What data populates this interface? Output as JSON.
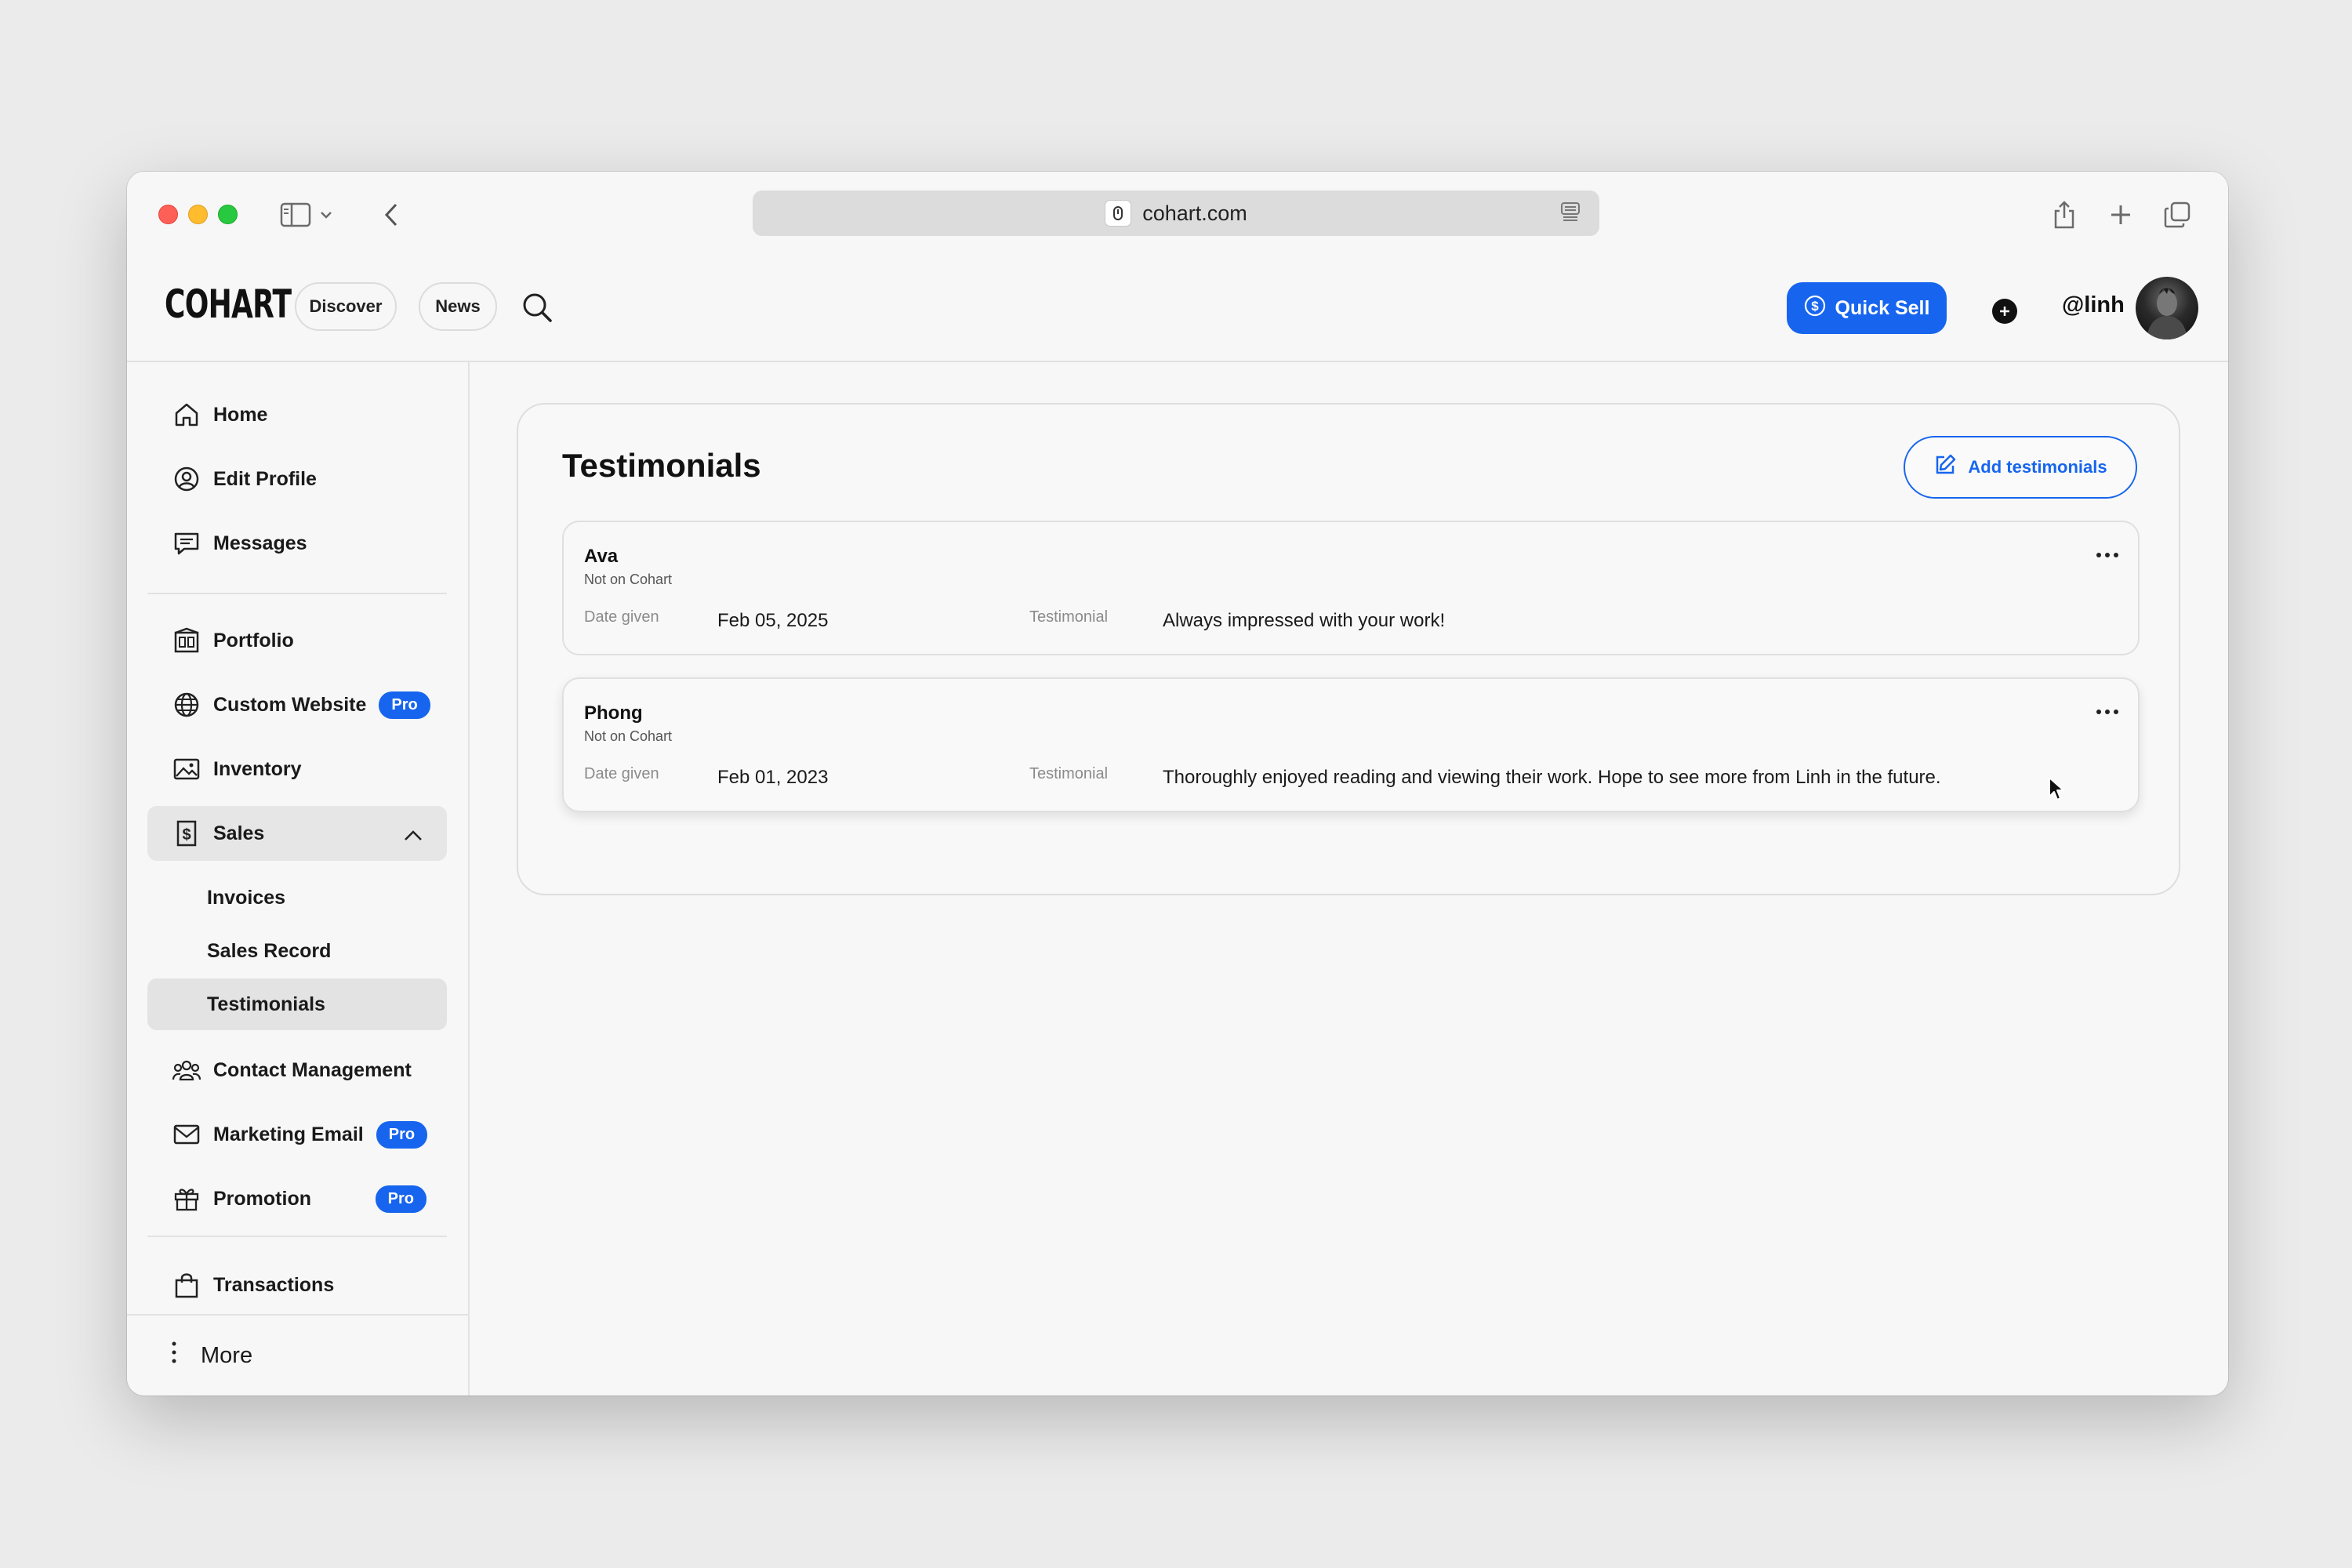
{
  "browser": {
    "url": "cohart.com"
  },
  "header": {
    "logo": "COHART",
    "nav": [
      "Discover",
      "News"
    ],
    "quick_sell_label": "Quick Sell",
    "username": "@linh"
  },
  "sidebar": {
    "items": [
      {
        "label": "Home",
        "icon": "home-icon"
      },
      {
        "label": "Edit Profile",
        "icon": "user-circle-icon"
      },
      {
        "label": "Messages",
        "icon": "chat-icon"
      },
      {
        "label": "Portfolio",
        "icon": "gallery-icon"
      },
      {
        "label": "Custom Website",
        "icon": "globe-icon",
        "badge": "Pro"
      },
      {
        "label": "Inventory",
        "icon": "image-icon"
      },
      {
        "label": "Sales",
        "icon": "dollar-doc-icon",
        "expanded": true,
        "children": [
          "Invoices",
          "Sales Record",
          "Testimonials"
        ],
        "active_child": "Testimonials"
      },
      {
        "label": "Contact Management",
        "icon": "people-icon"
      },
      {
        "label": "Marketing Email",
        "icon": "mail-icon",
        "badge": "Pro"
      },
      {
        "label": "Promotion",
        "icon": "gift-icon",
        "badge": "Pro"
      },
      {
        "label": "Transactions",
        "icon": "bag-icon"
      }
    ],
    "more_label": "More"
  },
  "main": {
    "title": "Testimonials",
    "add_button_label": "Add testimonials",
    "testimonials": [
      {
        "name": "Ava",
        "status": "Not on Cohart",
        "date_label": "Date given",
        "date": "Feb 05, 2025",
        "testimonial_label": "Testimonial",
        "text": "Always impressed with your work!"
      },
      {
        "name": "Phong",
        "status": "Not on Cohart",
        "date_label": "Date given",
        "date": "Feb 01, 2023",
        "testimonial_label": "Testimonial",
        "text": "Thoroughly enjoyed reading and viewing their work. Hope to see more from Linh in the future."
      }
    ]
  },
  "colors": {
    "accent": "#1765ee",
    "background": "#f7f7f7",
    "page_background": "#ebebeb"
  }
}
